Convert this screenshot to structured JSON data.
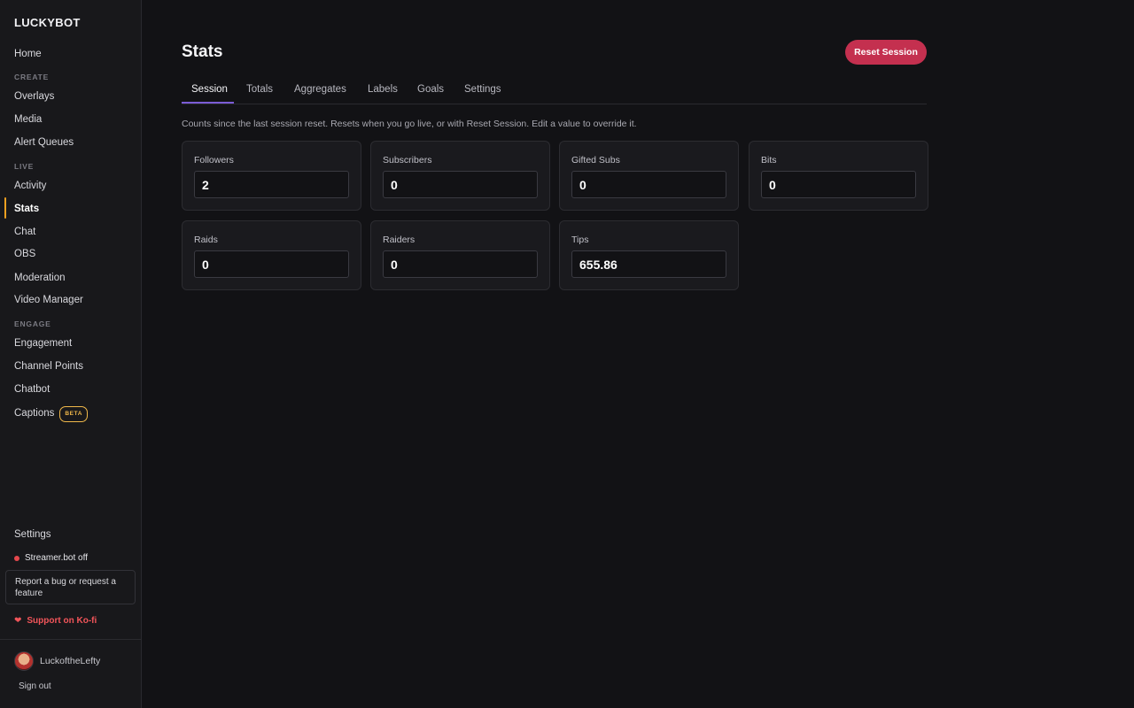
{
  "app": {
    "brand": "LUCKYBOT"
  },
  "sidebar": {
    "home": "Home",
    "create_header": "CREATE",
    "create_items": [
      "Overlays",
      "Media",
      "Alert Queues"
    ],
    "live_header": "LIVE",
    "live_items": [
      "Activity",
      "Stats",
      "Chat",
      "OBS",
      "Moderation",
      "Video Manager"
    ],
    "engage_header": "ENGAGE",
    "engage_items": [
      "Engagement",
      "Channel Points",
      "Chatbot",
      "Captions"
    ],
    "beta_badge": "BETA",
    "settings": "Settings",
    "streamerbot_status": "Streamer.bot off",
    "report_bug": "Report a bug or request a feature",
    "support": "Support on Ko-fi",
    "username": "LuckoftheLefty",
    "sign_out": "Sign out",
    "active_item": "Stats",
    "status_color": "#e5484d",
    "accent_color": "#f0a020"
  },
  "header": {
    "title": "Stats",
    "reset_button": "Reset Session",
    "reset_button_color": "#c4304f"
  },
  "tabs": {
    "items": [
      "Session",
      "Totals",
      "Aggregates",
      "Labels",
      "Goals",
      "Settings"
    ],
    "active": "Session",
    "underline_color": "#7b5cd6"
  },
  "session": {
    "description": "Counts since the last session reset. Resets when you go live, or with Reset Session. Edit a value to override it.",
    "stats": [
      {
        "label": "Followers",
        "value": "2"
      },
      {
        "label": "Subscribers",
        "value": "0"
      },
      {
        "label": "Gifted Subs",
        "value": "0"
      },
      {
        "label": "Bits",
        "value": "0"
      },
      {
        "label": "Raids",
        "value": "0"
      },
      {
        "label": "Raiders",
        "value": "0"
      },
      {
        "label": "Tips",
        "value": "655.86"
      }
    ]
  }
}
